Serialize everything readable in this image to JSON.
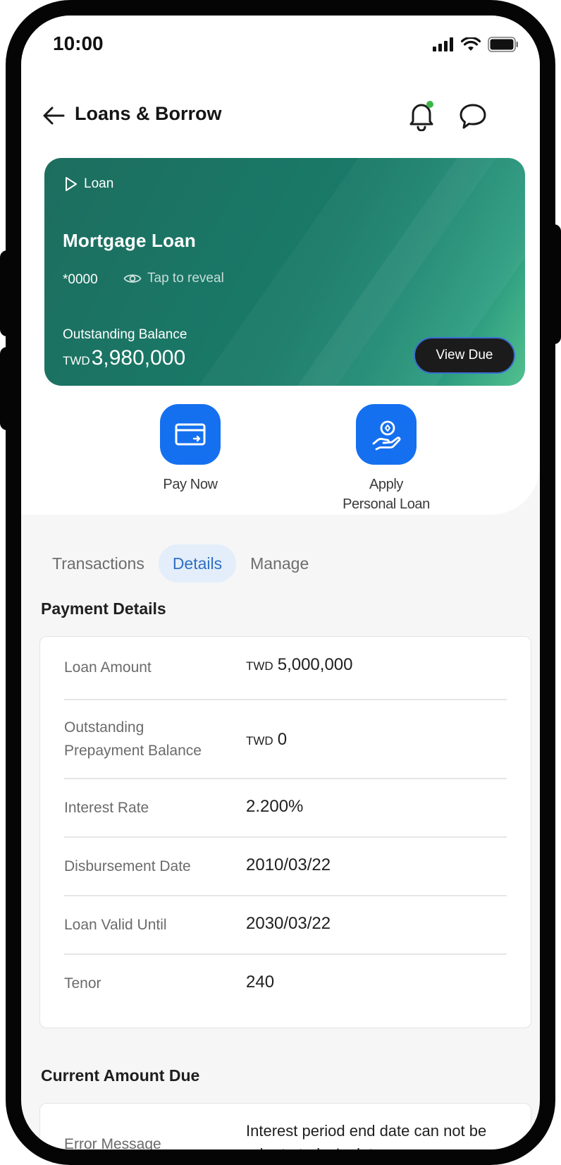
{
  "status_bar": {
    "time": "10:00"
  },
  "header": {
    "title": "Loans & Borrow"
  },
  "loan_card": {
    "tag": "Loan",
    "name": "Mortgage Loan",
    "number": "*0000",
    "reveal_label": "Tap to reveal",
    "balance_label": "Outstanding Balance",
    "balance_currency": "TWD",
    "balance_amount": "3,980,000",
    "view_due_label": "View Due"
  },
  "actions": {
    "pay_now": "Pay Now",
    "apply_line1": "Apply",
    "apply_line2": "Personal Loan"
  },
  "tabs": [
    "Transactions",
    "Details",
    "Manage"
  ],
  "active_tab": "Details",
  "payment_details": {
    "title": "Payment Details",
    "rows": [
      {
        "label": "Loan Amount",
        "currency": "TWD",
        "value": "5,000,000"
      },
      {
        "label": "Outstanding Prepayment Balance",
        "currency": "TWD",
        "value": "0"
      },
      {
        "label": "Interest Rate",
        "currency": "",
        "value": "2.200%"
      },
      {
        "label": "Disbursement Date",
        "currency": "",
        "value": "2010/03/22"
      },
      {
        "label": "Loan Valid Until",
        "currency": "",
        "value": "2030/03/22"
      },
      {
        "label": "Tenor",
        "currency": "",
        "value": "240"
      }
    ]
  },
  "current_amount_due": {
    "title": "Current Amount Due",
    "label": "Error Message",
    "value": "Interest period end date can not be prior to today's date."
  },
  "colors": {
    "primary_blue": "#1570ef",
    "card_green": "#1d6e5f",
    "active_tab_bg": "#e3eefa",
    "active_tab_text": "#2f6fc5",
    "notification_dot": "#3bb54a"
  }
}
